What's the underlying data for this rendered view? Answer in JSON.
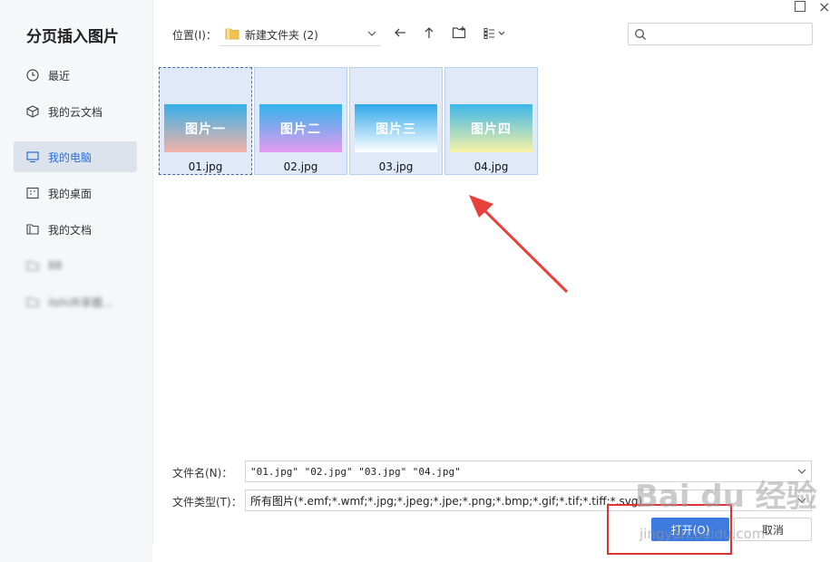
{
  "window": {
    "max_glyph": "",
    "close_glyph": "×"
  },
  "sidebar": {
    "title": "分页插入图片",
    "items": [
      {
        "label": "最近",
        "icon": "clock-icon"
      },
      {
        "label": "我的云文档",
        "icon": "cloud-box-icon"
      },
      {
        "label": "我的电脑",
        "icon": "monitor-icon",
        "active": true
      },
      {
        "label": "我的桌面",
        "icon": "desktop-icon"
      },
      {
        "label": "我的文档",
        "icon": "documents-icon"
      },
      {
        "label": "88",
        "icon": "folder-icon",
        "blurred": true
      },
      {
        "label": "ilshi共享圈...",
        "icon": "folder-icon",
        "blurred": true
      }
    ]
  },
  "toolbar": {
    "location_label": "位置(I)：",
    "location_value": "新建文件夹 (2)",
    "search_placeholder": ""
  },
  "files": [
    {
      "name": "01.jpg",
      "thumb_text": "图片一",
      "gradient": [
        "#36b0ea",
        "#f5b3a8"
      ]
    },
    {
      "name": "02.jpg",
      "thumb_text": "图片二",
      "gradient": [
        "#31b3ec",
        "#e69af0"
      ]
    },
    {
      "name": "03.jpg",
      "thumb_text": "图片三",
      "gradient": [
        "#2fa8ea",
        "#ffffff"
      ]
    },
    {
      "name": "04.jpg",
      "thumb_text": "图片四",
      "gradient": [
        "#3cb7ea",
        "#f6f2a4"
      ]
    }
  ],
  "form": {
    "filename_label": "文件名(N)：",
    "filename_value": "\"01.jpg\" \"02.jpg\" \"03.jpg\" \"04.jpg\"",
    "filetype_label": "文件类型(T)：",
    "filetype_value": "所有图片(*.emf;*.wmf;*.jpg;*.jpeg;*.jpe;*.png;*.bmp;*.gif;*.tif;*.tiff;*.svg)"
  },
  "buttons": {
    "open_label": "打开(O)",
    "cancel_label": "取消"
  },
  "watermark": {
    "main": "Bai du 经验",
    "sub": "jingyan.baidu.com"
  },
  "colors": {
    "accent": "#3d7be0",
    "annotation_red": "#e03333",
    "selection_bg": "#dfe9f8"
  }
}
